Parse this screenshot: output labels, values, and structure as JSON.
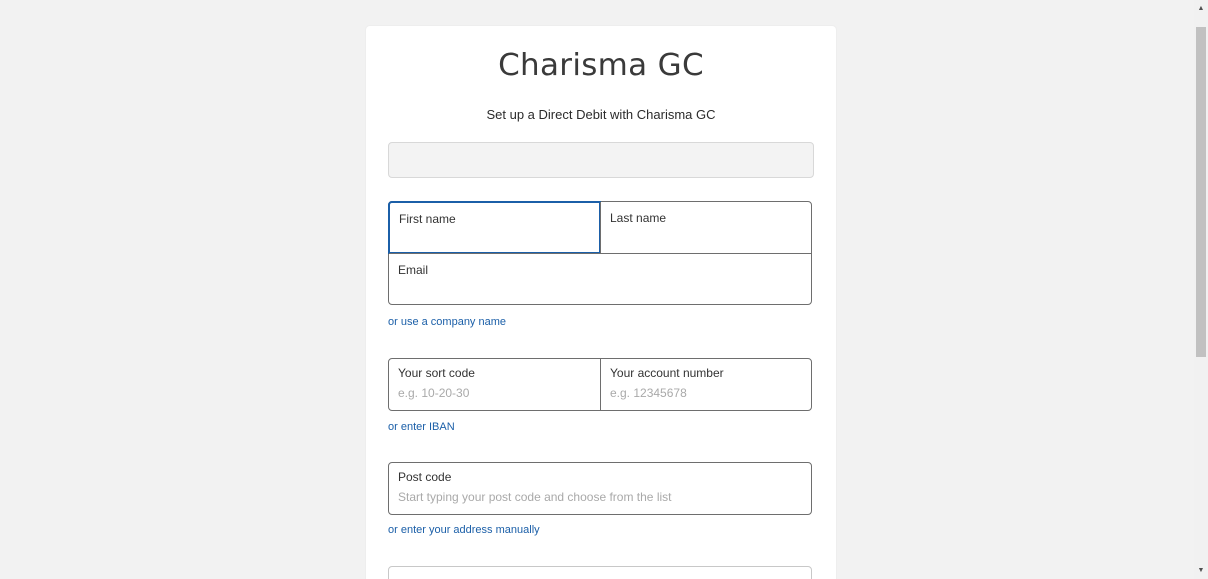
{
  "form": {
    "brand": "Charisma GC",
    "subtitle": "Set up a Direct Debit with Charisma GC",
    "plan_summary": "",
    "first_name": {
      "label": "First name",
      "value": ""
    },
    "last_name": {
      "label": "Last name",
      "value": ""
    },
    "email": {
      "label": "Email",
      "value": ""
    },
    "company_link": "or use a company name",
    "sort_code": {
      "label": "Your sort code",
      "placeholder": "e.g. 10-20-30"
    },
    "account_number": {
      "label": "Your account number",
      "placeholder": "e.g. 12345678"
    },
    "iban_link": "or enter IBAN",
    "post_code": {
      "label": "Post code",
      "placeholder": "Start typing your post code and choose from the list"
    },
    "address_link": "or enter your address manually"
  },
  "scrollbar": {
    "up_icon": "arrow-up-icon",
    "down_icon": "arrow-down-icon"
  },
  "colors": {
    "background": "#f2f2f2",
    "card": "#ffffff",
    "link": "#1b5fa8",
    "focus_border": "#1b5fa8",
    "border": "#6e6e6e",
    "placeholder": "#a9a9a9"
  }
}
